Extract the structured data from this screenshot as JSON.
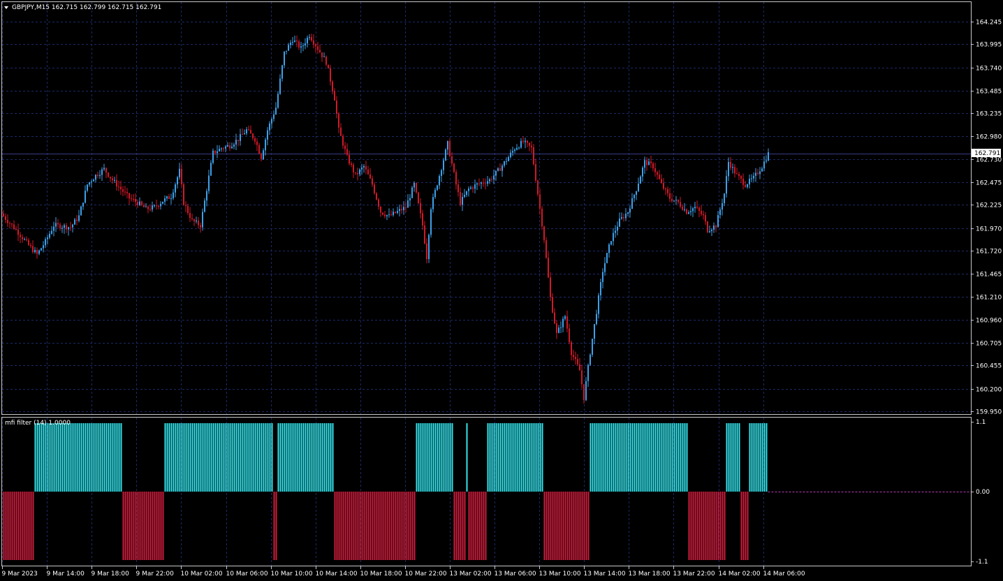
{
  "header": {
    "symbol_line": "GBPJPY,M15  162.715 162.799 162.715 162.791",
    "current_price": "162.791"
  },
  "colors": {
    "background": "#000000",
    "grid": "#1c2a66",
    "frame": "#c8c8c8",
    "bull": "#3fa0e8",
    "bear": "#d01a28",
    "current_line": "#3a3a8a",
    "hist_pos": "#33e4ec",
    "hist_neg": "#cc1d3c",
    "zero_line": "#b040b0",
    "text": "#ffffff"
  },
  "chart_data": [
    {
      "type": "candlestick",
      "title": "GBPJPY,M15",
      "y_ticks": [
        "164.245",
        "163.995",
        "163.740",
        "163.485",
        "163.235",
        "162.980",
        "162.730",
        "162.475",
        "162.225",
        "161.970",
        "161.720",
        "161.465",
        "161.210",
        "160.960",
        "160.705",
        "160.455",
        "160.200",
        "159.950"
      ],
      "y_tick_values": [
        164.245,
        163.995,
        163.74,
        163.485,
        163.235,
        162.98,
        162.73,
        162.475,
        162.225,
        161.97,
        161.72,
        161.465,
        161.21,
        160.96,
        160.705,
        160.455,
        160.2,
        159.95
      ],
      "x_ticks": [
        "9 Mar 2023",
        "9 Mar 14:00",
        "9 Mar 18:00",
        "9 Mar 22:00",
        "10 Mar 02:00",
        "10 Mar 06:00",
        "10 Mar 10:00",
        "10 Mar 14:00",
        "10 Mar 18:00",
        "10 Mar 22:00",
        "13 Mar 02:00",
        "13 Mar 06:00",
        "13 Mar 10:00",
        "13 Mar 14:00",
        "13 Mar 18:00",
        "13 Mar 22:00",
        "14 Mar 02:00",
        "14 Mar 06:00"
      ],
      "current_price": 162.791,
      "grid": true,
      "close_path": [
        [
          0,
          162.1
        ],
        [
          6,
          161.95
        ],
        [
          12,
          161.78
        ],
        [
          16,
          161.68
        ],
        [
          20,
          161.82
        ],
        [
          24,
          162.0
        ],
        [
          32,
          161.98
        ],
        [
          36,
          162.1
        ],
        [
          40,
          162.45
        ],
        [
          44,
          162.55
        ],
        [
          48,
          162.62
        ],
        [
          52,
          162.5
        ],
        [
          56,
          162.4
        ],
        [
          60,
          162.3
        ],
        [
          64,
          162.25
        ],
        [
          68,
          162.18
        ],
        [
          72,
          162.2
        ],
        [
          76,
          162.27
        ],
        [
          80,
          162.32
        ],
        [
          84,
          162.6
        ],
        [
          86,
          162.25
        ],
        [
          90,
          162.05
        ],
        [
          94,
          162.0
        ],
        [
          97,
          162.4
        ],
        [
          100,
          162.8
        ],
        [
          104,
          162.85
        ],
        [
          108,
          162.88
        ],
        [
          112,
          162.95
        ],
        [
          116,
          163.05
        ],
        [
          120,
          162.95
        ],
        [
          123,
          162.75
        ],
        [
          126,
          163.05
        ],
        [
          130,
          163.3
        ],
        [
          134,
          163.9
        ],
        [
          138,
          164.05
        ],
        [
          142,
          163.95
        ],
        [
          146,
          164.1
        ],
        [
          150,
          163.95
        ],
        [
          154,
          163.8
        ],
        [
          158,
          163.4
        ],
        [
          160,
          163.05
        ],
        [
          164,
          162.75
        ],
        [
          168,
          162.55
        ],
        [
          172,
          162.65
        ],
        [
          176,
          162.45
        ],
        [
          180,
          162.15
        ],
        [
          184,
          162.1
        ],
        [
          188,
          162.15
        ],
        [
          192,
          162.2
        ],
        [
          196,
          162.45
        ],
        [
          200,
          162.0
        ],
        [
          202,
          161.65
        ],
        [
          204,
          162.2
        ],
        [
          208,
          162.55
        ],
        [
          212,
          162.9
        ],
        [
          216,
          162.45
        ],
        [
          218,
          162.25
        ],
        [
          222,
          162.4
        ],
        [
          226,
          162.45
        ],
        [
          232,
          162.5
        ],
        [
          236,
          162.6
        ],
        [
          240,
          162.72
        ],
        [
          244,
          162.85
        ],
        [
          248,
          162.92
        ],
        [
          252,
          162.85
        ],
        [
          255,
          162.35
        ],
        [
          258,
          161.85
        ],
        [
          261,
          161.2
        ],
        [
          264,
          160.8
        ],
        [
          268,
          161.0
        ],
        [
          271,
          160.6
        ],
        [
          275,
          160.4
        ],
        [
          277,
          160.1
        ],
        [
          280,
          160.6
        ],
        [
          283,
          161.05
        ],
        [
          286,
          161.5
        ],
        [
          290,
          161.85
        ],
        [
          294,
          162.05
        ],
        [
          298,
          162.15
        ],
        [
          302,
          162.4
        ],
        [
          306,
          162.7
        ],
        [
          310,
          162.65
        ],
        [
          314,
          162.45
        ],
        [
          318,
          162.3
        ],
        [
          322,
          162.25
        ],
        [
          326,
          162.15
        ],
        [
          330,
          162.2
        ],
        [
          334,
          162.1
        ],
        [
          336,
          161.95
        ],
        [
          340,
          162.0
        ],
        [
          344,
          162.35
        ],
        [
          346,
          162.7
        ],
        [
          350,
          162.55
        ],
        [
          354,
          162.45
        ],
        [
          358,
          162.52
        ],
        [
          362,
          162.65
        ],
        [
          365,
          162.79
        ]
      ],
      "indicator": {
        "name": "mfi filter (14) 1.0000",
        "y_ticks": [
          "1.1",
          "0.00",
          "-1.1"
        ],
        "segments": [
          {
            "from": 0,
            "to": 14,
            "value": -1
          },
          {
            "from": 15,
            "to": 56,
            "value": 1
          },
          {
            "from": 57,
            "to": 76,
            "value": -1
          },
          {
            "from": 77,
            "to": 128,
            "value": 1
          },
          {
            "from": 129,
            "to": 130,
            "value": -1
          },
          {
            "from": 131,
            "to": 157,
            "value": 1
          },
          {
            "from": 158,
            "to": 196,
            "value": -1
          },
          {
            "from": 197,
            "to": 214,
            "value": 1
          },
          {
            "from": 215,
            "to": 220,
            "value": -1
          },
          {
            "from": 221,
            "to": 221,
            "value": 1
          },
          {
            "from": 222,
            "to": 230,
            "value": -1
          },
          {
            "from": 231,
            "to": 257,
            "value": 1
          },
          {
            "from": 258,
            "to": 279,
            "value": -1
          },
          {
            "from": 280,
            "to": 326,
            "value": 1
          },
          {
            "from": 327,
            "to": 344,
            "value": -1
          },
          {
            "from": 345,
            "to": 351,
            "value": 1
          },
          {
            "from": 352,
            "to": 355,
            "value": -1
          },
          {
            "from": 356,
            "to": 364,
            "value": 1
          }
        ]
      }
    }
  ]
}
